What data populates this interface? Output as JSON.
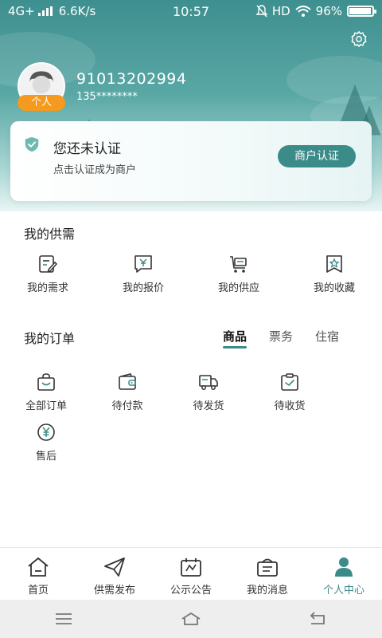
{
  "status_bar": {
    "network": "4G+",
    "speed": "6.6K/s",
    "time": "10:57",
    "hd": "HD",
    "battery_text": "96%",
    "battery_level": 0.96
  },
  "profile": {
    "user_id": "91013202994",
    "phone": "135********",
    "role_badge": "个人"
  },
  "verify_card": {
    "title": "您还未认证",
    "subtitle": "点击认证成为商户",
    "button": "商户认证"
  },
  "supply": {
    "title": "我的供需",
    "items": [
      {
        "label": "我的需求",
        "icon": "edit-doc-icon"
      },
      {
        "label": "我的报价",
        "icon": "yen-chat-icon"
      },
      {
        "label": "我的供应",
        "icon": "cart-icon"
      },
      {
        "label": "我的收藏",
        "icon": "star-bookmark-icon"
      }
    ]
  },
  "orders": {
    "title": "我的订单",
    "tabs": [
      "商品",
      "票务",
      "住宿"
    ],
    "active_tab": 0,
    "items": [
      {
        "label": "全部订单",
        "icon": "bag-icon"
      },
      {
        "label": "待付款",
        "icon": "wallet-icon"
      },
      {
        "label": "待发货",
        "icon": "truck-icon"
      },
      {
        "label": "待收货",
        "icon": "clipboard-check-icon"
      },
      {
        "label": "售后",
        "icon": "yen-circle-icon"
      }
    ]
  },
  "bottom_nav": {
    "items": [
      {
        "label": "首页",
        "icon": "home-icon"
      },
      {
        "label": "供需发布",
        "icon": "send-icon"
      },
      {
        "label": "公示公告",
        "icon": "announcement-icon"
      },
      {
        "label": "我的消息",
        "icon": "message-icon"
      },
      {
        "label": "个人中心",
        "icon": "person-icon"
      }
    ],
    "active": 4
  },
  "colors": {
    "accent": "#3b8b89",
    "badge": "#f39a1f"
  }
}
